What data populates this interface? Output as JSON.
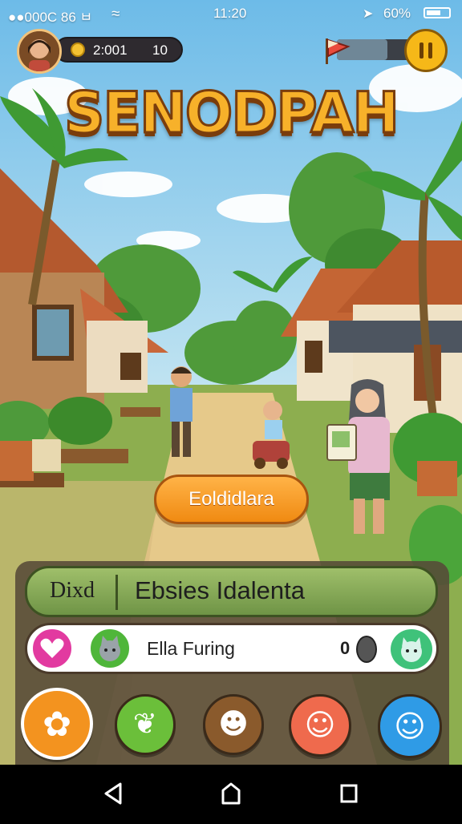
{
  "status_bar": {
    "carrier": "●●000C 86 ㅂ",
    "time": "11:20",
    "battery": "60%"
  },
  "player": {
    "coins": "2:001",
    "count": "10",
    "progress": 0.68
  },
  "game": {
    "title": "SENODPAH"
  },
  "scene": {
    "action_button": "Eoldidlara"
  },
  "bottom_panel": {
    "location_tag": "Dixd",
    "location_name": "Ebsies Idalenta",
    "chat_name": "Ella Furing",
    "chat_count": "0"
  },
  "actions": [
    {
      "icon": "paw-icon",
      "color": "#f3931f"
    },
    {
      "icon": "leaf-icon",
      "color": "#6bbf3a"
    },
    {
      "icon": "bear-icon",
      "color": "#8a5a2c"
    },
    {
      "icon": "face-icon",
      "color": "#ef6a4d"
    },
    {
      "icon": "cat-icon",
      "color": "#2f9be6"
    }
  ],
  "colors": {
    "sky": "#86c8ea",
    "accent": "#f7b12a",
    "panel": "#564a38"
  }
}
